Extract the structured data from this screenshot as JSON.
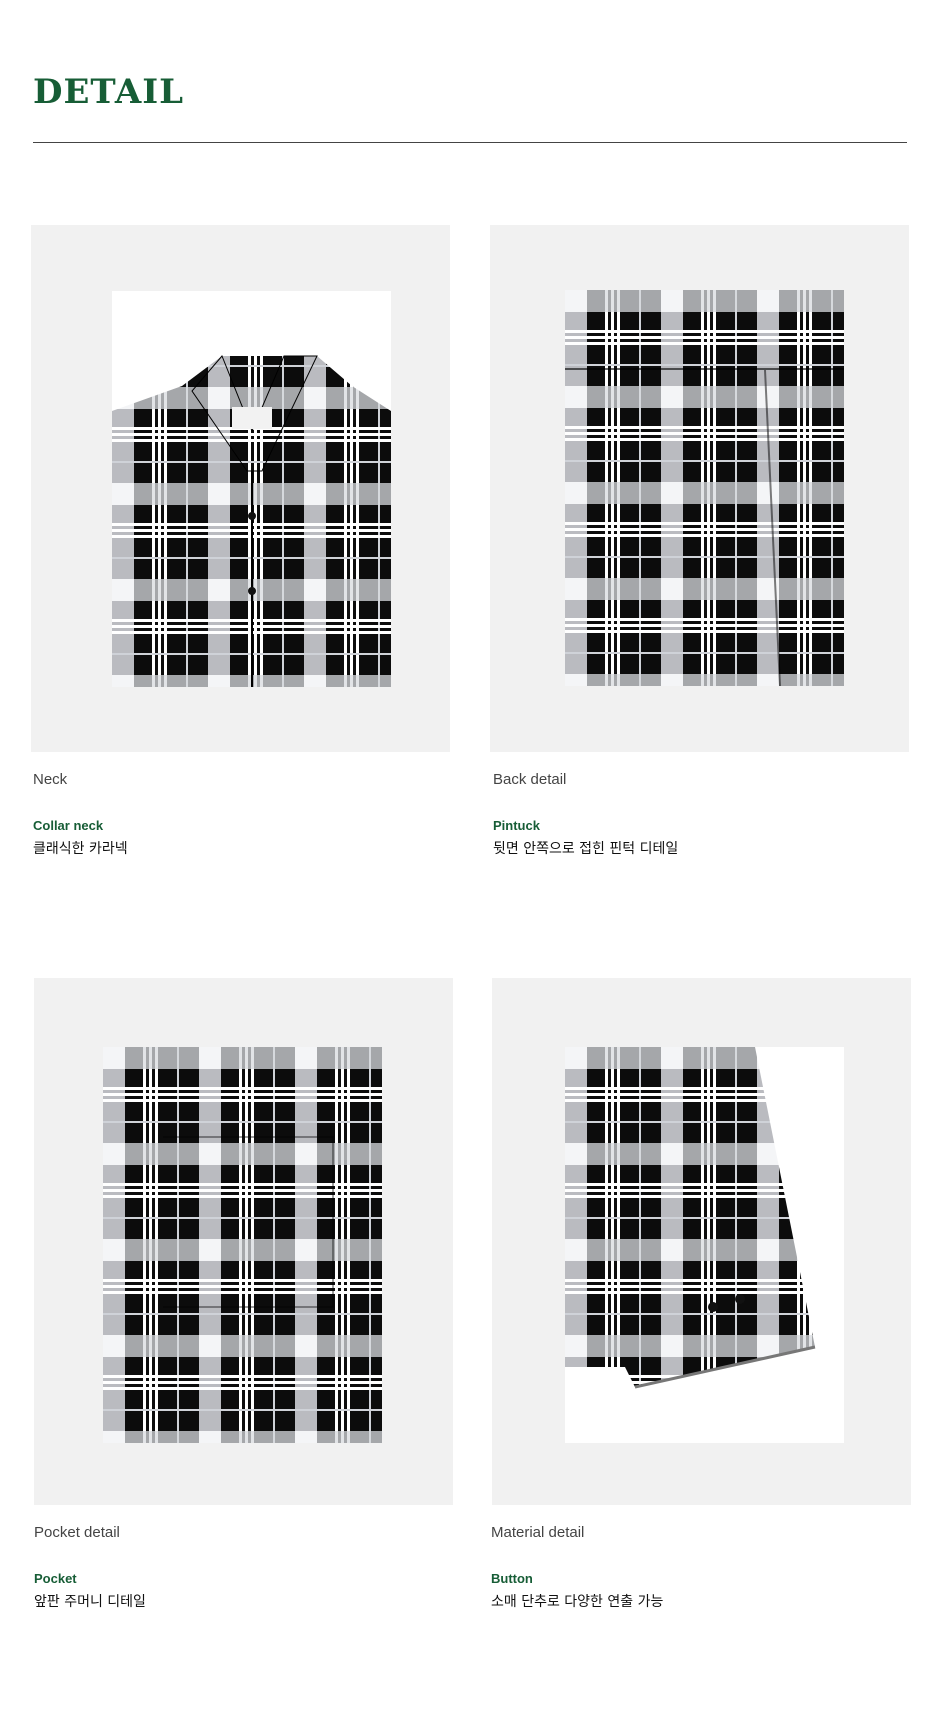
{
  "header": {
    "title": "DETAIL"
  },
  "details": [
    {
      "caption": "Neck",
      "feature_title": "Collar neck",
      "feature_desc": "클래식한 카라넥",
      "image_icon": "shirt-collar-photo"
    },
    {
      "caption": "Back detail",
      "feature_title": "Pintuck",
      "feature_desc": "뒷면 안쪽으로 접힌 핀턱 디테일",
      "image_icon": "shirt-back-photo"
    },
    {
      "caption": "Pocket detail",
      "feature_title": "Pocket",
      "feature_desc": "앞판 주머니 디테일",
      "image_icon": "shirt-pocket-photo"
    },
    {
      "caption": "Material detail",
      "feature_title": "Button",
      "feature_desc": "소매 단추로 다양한 연출 가능",
      "image_icon": "shirt-cuff-photo"
    }
  ],
  "colors": {
    "accent": "#175d36",
    "panel_bg": "#f1f1f1",
    "fabric_dark": "#0c0c0c",
    "fabric_light": "#d8dadf"
  }
}
